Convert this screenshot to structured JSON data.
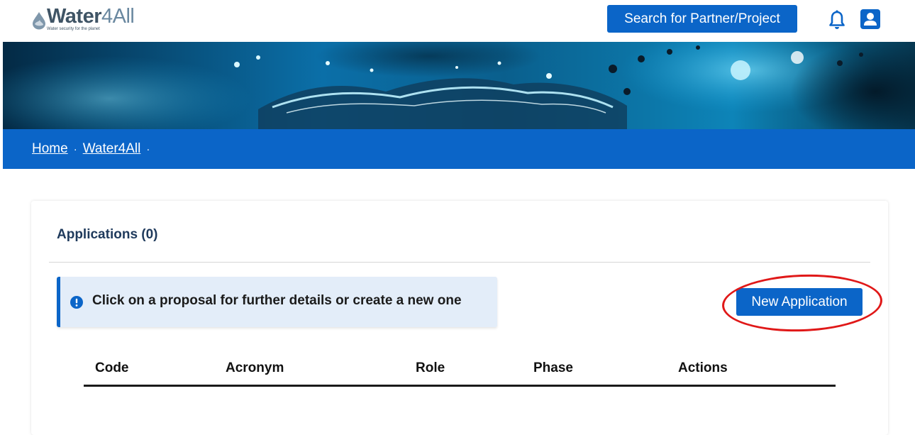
{
  "header": {
    "logo": {
      "word_bold": "Water",
      "word_light": "4All",
      "tagline": "Water security for the planet"
    },
    "search_button_label": "Search for Partner/Project",
    "icons": {
      "notifications": "bell-icon",
      "account": "user-icon"
    }
  },
  "breadcrumb": {
    "items": [
      "Home",
      "Water4All"
    ],
    "separator": "·"
  },
  "applications": {
    "title": "Applications (0)",
    "info_message": "Click on a proposal for further details or create a new one",
    "new_button_label": "New Application",
    "columns": [
      "Code",
      "Acronym",
      "Role",
      "Phase",
      "Actions"
    ],
    "rows": []
  },
  "colors": {
    "primary": "#0b65c8",
    "info_bg": "#e3edf9",
    "title": "#1f3a5c",
    "highlight": "#e01818"
  }
}
